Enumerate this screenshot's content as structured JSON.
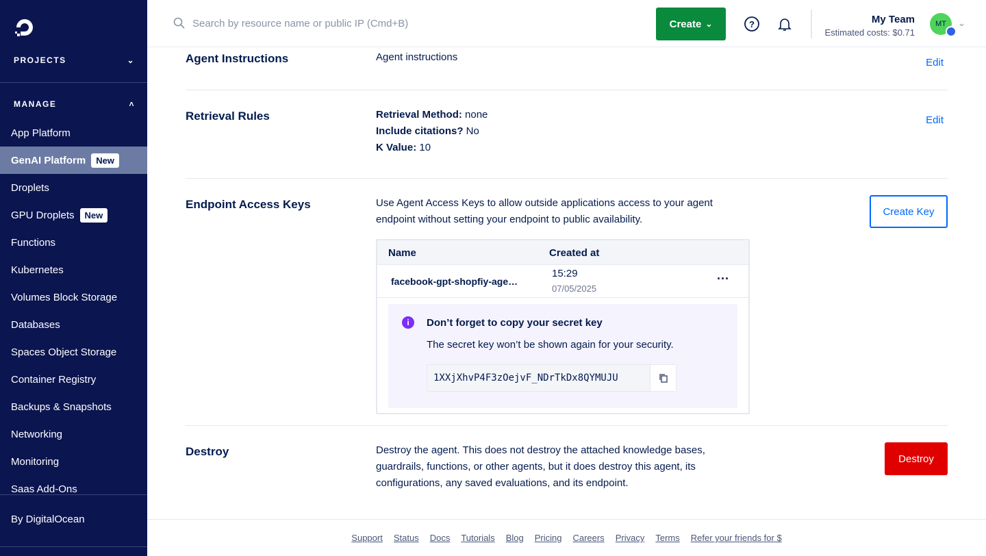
{
  "sidebar": {
    "projects": "PROJECTS",
    "manage": "MANAGE",
    "items": [
      {
        "label": "App Platform"
      },
      {
        "label": "GenAI Platform",
        "badge": "New",
        "active": true
      },
      {
        "label": "Droplets"
      },
      {
        "label": "GPU Droplets",
        "badge": "New"
      },
      {
        "label": "Functions"
      },
      {
        "label": "Kubernetes"
      },
      {
        "label": "Volumes Block Storage"
      },
      {
        "label": "Databases"
      },
      {
        "label": "Spaces Object Storage"
      },
      {
        "label": "Container Registry"
      },
      {
        "label": "Backups & Snapshots"
      },
      {
        "label": "Networking"
      },
      {
        "label": "Monitoring"
      },
      {
        "label": "Saas Add-Ons"
      }
    ],
    "bottom": "By DigitalOcean"
  },
  "header": {
    "search_placeholder": "Search by resource name or public IP (Cmd+B)",
    "create": "Create",
    "team": "My Team",
    "costs": "Estimated costs: $0.71",
    "avatar": "MT"
  },
  "sections": {
    "instructions": {
      "label": "Agent Instructions",
      "text": "Agent instructions",
      "edit": "Edit"
    },
    "retrieval": {
      "label": "Retrieval Rules",
      "method_k": "Retrieval Method:",
      "method_v": " none",
      "cit_k": "Include citations?",
      "cit_v": " No",
      "k_k": "K Value:",
      "k_v": " 10",
      "edit": "Edit"
    },
    "keys": {
      "label": "Endpoint Access Keys",
      "desc": "Use Agent Access Keys to allow outside applications access to your agent endpoint without setting your endpoint to public availability.",
      "create": "Create Key",
      "columns": [
        "Name",
        "Created at"
      ],
      "row": {
        "name": "facebook-gpt-shopfiy-age…",
        "time": "15:29",
        "date": "07/05/2025"
      },
      "alert": {
        "title": "Don’t forget to copy your secret key",
        "text": "The secret key won’t be shown again for your security.",
        "key": "1XXjXhvP4F3zOejvF_NDrTkDx8QYMUJU"
      }
    },
    "destroy": {
      "label": "Destroy",
      "desc": "Destroy the agent. This does not destroy the attached knowledge bases, guardrails, functions, or other agents, but it does destroy this agent, its configurations, any saved evaluations, and its endpoint.",
      "button": "Destroy"
    }
  },
  "footer": [
    "Support",
    "Status",
    "Docs",
    "Tutorials",
    "Blog",
    "Pricing",
    "Careers",
    "Privacy",
    "Terms",
    "Refer your friends for $"
  ],
  "colors": {
    "sidebar": "#0b1550",
    "create": "#0a8a3d",
    "link": "#0069ff",
    "danger": "#e00000",
    "info": "#7b2ff7"
  }
}
